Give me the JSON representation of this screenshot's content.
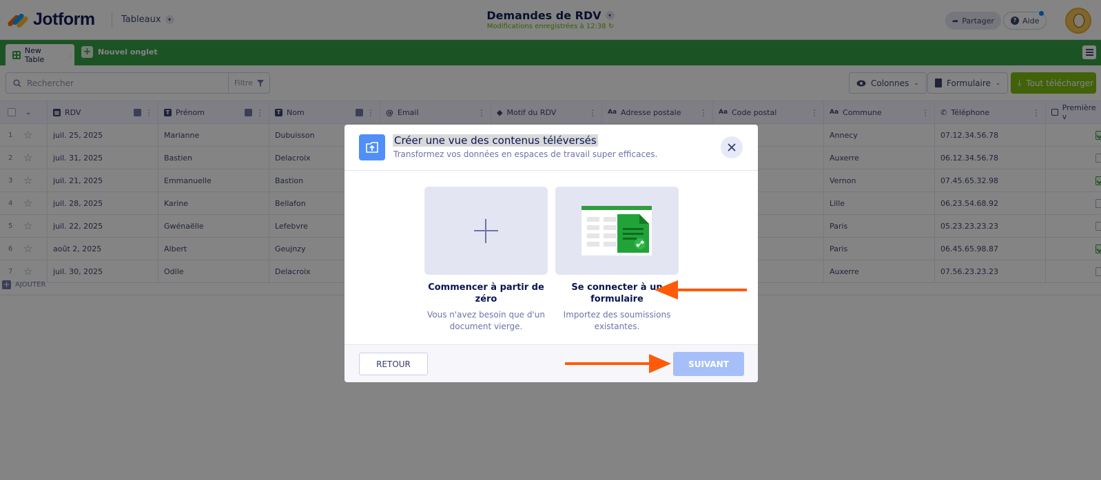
{
  "app": {
    "logo_text": "Jotform",
    "tables_menu": "Tableaux",
    "doc_title": "Demandes de RDV",
    "save_status": "Modifications enregistrées à 12:38",
    "share_label": "Partager",
    "help_label": "Aide"
  },
  "tabs": {
    "active_label": "New Table",
    "new_tab_label": "Nouvel onglet"
  },
  "toolbar": {
    "search_placeholder": "Rechercher",
    "filter_label": "Filtre",
    "columns_label": "Colonnes",
    "form_label": "Formulaire",
    "download_label": "Tout télécharger"
  },
  "table": {
    "columns": [
      "RDV",
      "Prénom",
      "Nom",
      "Email",
      "Motif du RDV",
      "Adresse postale",
      "Code postal",
      "Commune",
      "Téléphone",
      "Première v"
    ],
    "rows": [
      {
        "num": "1",
        "rdv": "juil. 25, 2025",
        "prenom": "Marianne",
        "nom": "Dubuisson",
        "commune": "Annecy",
        "tel": "07.12.34.56.78",
        "checked": true
      },
      {
        "num": "2",
        "rdv": "juil. 31, 2025",
        "prenom": "Bastien",
        "nom": "Delacroix",
        "commune": "Auxerre",
        "tel": "06.12.34.56.78",
        "checked": false
      },
      {
        "num": "3",
        "rdv": "juil. 21, 2025",
        "prenom": "Emmanuelle",
        "nom": "Bastion",
        "commune": "Vernon",
        "tel": "07.45.65.32.98",
        "checked": true
      },
      {
        "num": "4",
        "rdv": "juil. 28, 2025",
        "prenom": "Karine",
        "nom": "Bellafon",
        "commune": "Lille",
        "tel": "06.23.54.68.92",
        "checked": false
      },
      {
        "num": "5",
        "rdv": "juil. 22, 2025",
        "prenom": "Gwénaëlle",
        "nom": "Lefebvre",
        "commune": "Paris",
        "tel": "05.23.23.23.23",
        "checked": false
      },
      {
        "num": "6",
        "rdv": "août 2, 2025",
        "prenom": "Albert",
        "nom": "Geujnzy",
        "commune": "Paris",
        "tel": "06.45.65.98.87",
        "checked": true
      },
      {
        "num": "7",
        "rdv": "juil. 30, 2025",
        "prenom": "Odile",
        "nom": "Delacroix",
        "commune": "Auxerre",
        "tel": "07.56.23.23.23",
        "checked": false
      }
    ],
    "add_label": "AJOUTER"
  },
  "modal": {
    "title": "Créer une vue des contenus téléversés",
    "subtitle": "Transformez vos données en espaces de travail super efficaces.",
    "option_blank_title": "Commencer à partir de zéro",
    "option_blank_desc": "Vous n'avez besoin que d'un document vierge.",
    "option_form_title": "Se connecter à un formulaire",
    "option_form_desc": "Importez des soumissions existantes.",
    "back_label": "RETOUR",
    "next_label": "SUIVANT"
  },
  "colors": {
    "brand_green": "#2f9d3e",
    "download_green": "#78bb07",
    "next_button": "#a6bff8",
    "annotation_arrow": "#ff5a0a"
  }
}
